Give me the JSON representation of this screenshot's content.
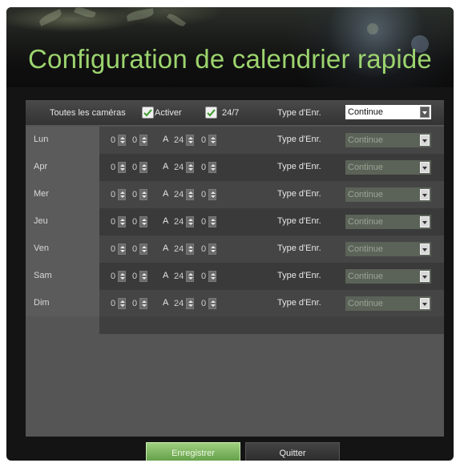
{
  "title": "Configuration de calendrier rapide",
  "header_row": {
    "all_cameras_label": "Toutes les caméras",
    "enable_label": "Activer",
    "enable_checked": true,
    "h24_label": "24/7",
    "h24_checked": true,
    "record_type_label": "Type d'Enr.",
    "record_type_value": "Continue"
  },
  "separator_label": "A",
  "days": [
    {
      "day": "Lun",
      "start_h": "0",
      "start_m": "0",
      "end_h": "24",
      "end_m": "0",
      "record_type_label": "Type d'Enr.",
      "record_type": "Continue"
    },
    {
      "day": "Apr",
      "start_h": "0",
      "start_m": "0",
      "end_h": "24",
      "end_m": "0",
      "record_type_label": "Type d'Enr.",
      "record_type": "Continue"
    },
    {
      "day": "Mer",
      "start_h": "0",
      "start_m": "0",
      "end_h": "24",
      "end_m": "0",
      "record_type_label": "Type d'Enr.",
      "record_type": "Continue"
    },
    {
      "day": "Jeu",
      "start_h": "0",
      "start_m": "0",
      "end_h": "24",
      "end_m": "0",
      "record_type_label": "Type d'Enr.",
      "record_type": "Continue"
    },
    {
      "day": "Ven",
      "start_h": "0",
      "start_m": "0",
      "end_h": "24",
      "end_m": "0",
      "record_type_label": "Type d'Enr.",
      "record_type": "Continue"
    },
    {
      "day": "Sam",
      "start_h": "0",
      "start_m": "0",
      "end_h": "24",
      "end_m": "0",
      "record_type_label": "Type d'Enr.",
      "record_type": "Continue"
    },
    {
      "day": "Dim",
      "start_h": "0",
      "start_m": "0",
      "end_h": "24",
      "end_m": "0",
      "record_type_label": "Type d'Enr.",
      "record_type": "Continue"
    }
  ],
  "buttons": {
    "save_label": "Enregistrer",
    "quit_label": "Quitter"
  },
  "colors": {
    "title_green": "#9cd46e",
    "save_button": "#7ab85e"
  }
}
